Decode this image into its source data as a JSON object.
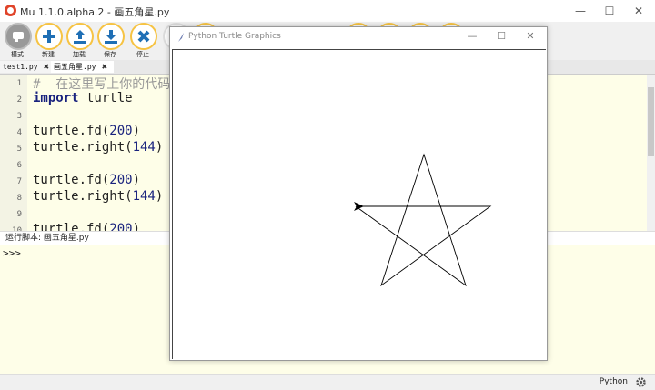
{
  "window": {
    "title": "Mu 1.1.0.alpha.2 - 画五角星.py",
    "minimize": "—",
    "maximize": "☐",
    "close": "✕"
  },
  "toolbar": {
    "buttons": [
      {
        "label": "模式",
        "icon": "mode-icon"
      },
      {
        "label": "新建",
        "icon": "plus-icon"
      },
      {
        "label": "加载",
        "icon": "upload-icon"
      },
      {
        "label": "保存",
        "icon": "download-icon"
      },
      {
        "label": "停止",
        "icon": "close-x-icon"
      }
    ]
  },
  "tabs": [
    {
      "label": "test1.py",
      "close": "✖"
    },
    {
      "label": "画五角星.py",
      "close": "✖"
    }
  ],
  "editor": {
    "lines": [
      {
        "num": "1",
        "text": "#  在这里写上你的代码"
      },
      {
        "num": "2",
        "text": "import turtle"
      },
      {
        "num": "3",
        "text": ""
      },
      {
        "num": "4",
        "text": "turtle.fd(200)"
      },
      {
        "num": "5",
        "text": "turtle.right(144)"
      },
      {
        "num": "6",
        "text": ""
      },
      {
        "num": "7",
        "text": "turtle.fd(200)"
      },
      {
        "num": "8",
        "text": "turtle.right(144)"
      },
      {
        "num": "9",
        "text": ""
      },
      {
        "num": "10",
        "text": "turtle.fd(200)"
      }
    ]
  },
  "repl": {
    "label": "运行脚本: 画五角星.py",
    "prompt": ">>>"
  },
  "status": {
    "mode": "Python",
    "gear_icon": "gear-icon"
  },
  "turtle_window": {
    "title": "Python Turtle Graphics",
    "minimize": "—",
    "maximize": "☐",
    "close": "✕"
  },
  "colors": {
    "accent": "#f6c343",
    "editor_bg": "#fefee8",
    "keyword": "#1a237e",
    "comment": "#999999",
    "number": "#1a237e"
  }
}
